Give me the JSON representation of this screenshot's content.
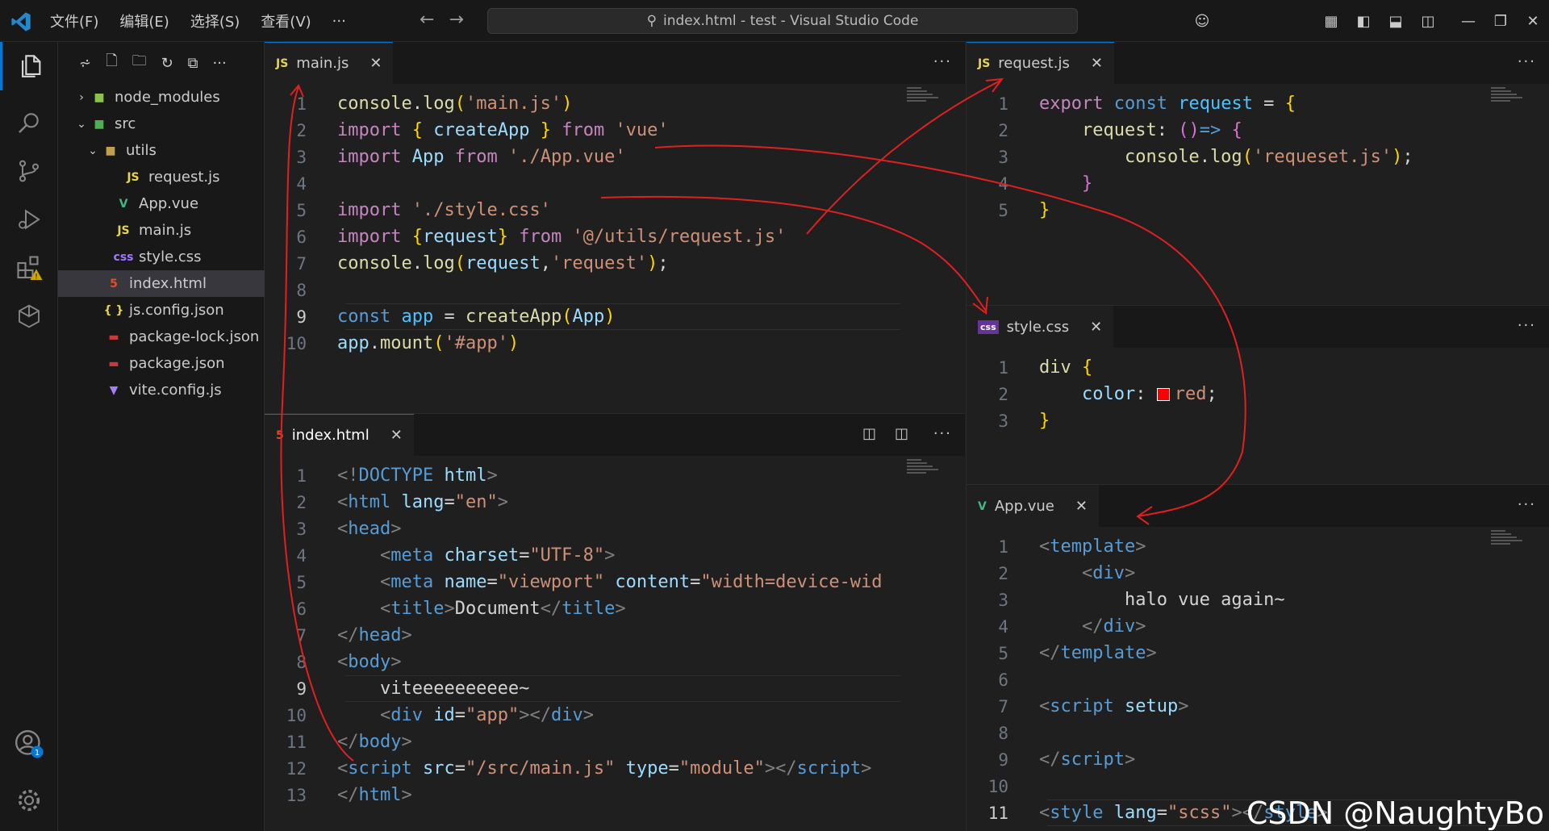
{
  "window": {
    "title": "index.html - test - Visual Studio Code"
  },
  "menu": {
    "items": [
      "文件(F)",
      "编辑(E)",
      "选择(S)",
      "查看(V)",
      "···"
    ]
  },
  "explorer": {
    "items": [
      {
        "label": "node_modules",
        "icon": "folder-node-icon"
      },
      {
        "label": "src",
        "icon": "folder-src-icon"
      },
      {
        "label": "utils",
        "icon": "folder-utils-icon"
      },
      {
        "label": "request.js",
        "icon": "js-file-icon"
      },
      {
        "label": "App.vue",
        "icon": "vue-file-icon"
      },
      {
        "label": "main.js",
        "icon": "js-file-icon"
      },
      {
        "label": "style.css",
        "icon": "css-file-icon"
      },
      {
        "label": "index.html",
        "icon": "html-file-icon"
      },
      {
        "label": "js.config.json",
        "icon": "json-file-icon"
      },
      {
        "label": "package-lock.json",
        "icon": "npm-file-icon"
      },
      {
        "label": "package.json",
        "icon": "npm-file-icon"
      },
      {
        "label": "vite.config.js",
        "icon": "vite-file-icon"
      }
    ]
  },
  "icons": {
    "js": "JS",
    "css": "css",
    "html": "5",
    "json": "{ }",
    "vue": "V"
  },
  "editors": {
    "main": {
      "tab": "main.js",
      "lines": [
        {
          "n": "1",
          "tokens": [
            [
              "fn",
              "console"
            ],
            [
              "pl",
              "."
            ],
            [
              "fn",
              "log"
            ],
            [
              "br",
              "("
            ],
            [
              "st",
              "'main.js'"
            ],
            [
              "br",
              ")"
            ]
          ]
        },
        {
          "n": "2",
          "tokens": [
            [
              "kc",
              "import"
            ],
            [
              "pl",
              " "
            ],
            [
              "br",
              "{"
            ],
            [
              "pl",
              " "
            ],
            [
              "vr",
              "createApp"
            ],
            [
              "pl",
              " "
            ],
            [
              "br",
              "}"
            ],
            [
              "pl",
              " "
            ],
            [
              "kc",
              "from"
            ],
            [
              "pl",
              " "
            ],
            [
              "st",
              "'vue'"
            ]
          ]
        },
        {
          "n": "3",
          "tokens": [
            [
              "kc",
              "import"
            ],
            [
              "pl",
              " "
            ],
            [
              "vr",
              "App"
            ],
            [
              "pl",
              " "
            ],
            [
              "kc",
              "from"
            ],
            [
              "pl",
              " "
            ],
            [
              "st",
              "'./App.vue'"
            ]
          ]
        },
        {
          "n": "4",
          "tokens": []
        },
        {
          "n": "5",
          "tokens": [
            [
              "kc",
              "import"
            ],
            [
              "pl",
              " "
            ],
            [
              "st",
              "'./style.css'"
            ]
          ]
        },
        {
          "n": "6",
          "tokens": [
            [
              "kc",
              "import"
            ],
            [
              "pl",
              " "
            ],
            [
              "br",
              "{"
            ],
            [
              "vr",
              "request"
            ],
            [
              "br",
              "}"
            ],
            [
              "pl",
              " "
            ],
            [
              "kc",
              "from"
            ],
            [
              "pl",
              " "
            ],
            [
              "st",
              "'@/utils/request.js'"
            ]
          ]
        },
        {
          "n": "7",
          "tokens": [
            [
              "fn",
              "console"
            ],
            [
              "pl",
              "."
            ],
            [
              "fn",
              "log"
            ],
            [
              "br",
              "("
            ],
            [
              "vr",
              "request"
            ],
            [
              "pl",
              ","
            ],
            [
              "st",
              "'request'"
            ],
            [
              "br",
              ")"
            ],
            [
              "pl",
              ";"
            ]
          ]
        },
        {
          "n": "8",
          "tokens": []
        },
        {
          "n": "9",
          "tokens": [
            [
              "kw",
              "const"
            ],
            [
              "pl",
              " "
            ],
            [
              "cn",
              "app"
            ],
            [
              "pl",
              " = "
            ],
            [
              "fn",
              "createApp"
            ],
            [
              "br",
              "("
            ],
            [
              "vr",
              "App"
            ],
            [
              "br",
              ")"
            ]
          ]
        },
        {
          "n": "10",
          "tokens": [
            [
              "vr",
              "app"
            ],
            [
              "pl",
              "."
            ],
            [
              "fn",
              "mount"
            ],
            [
              "br",
              "("
            ],
            [
              "st",
              "'#app'"
            ],
            [
              "br",
              ")"
            ]
          ]
        }
      ]
    },
    "index": {
      "tab": "index.html",
      "lines": [
        {
          "n": "1",
          "tokens": [
            [
              "pu",
              "<!"
            ],
            [
              "tg",
              "DOCTYPE"
            ],
            [
              "pl",
              " "
            ],
            [
              "at",
              "html"
            ],
            [
              "pu",
              ">"
            ]
          ]
        },
        {
          "n": "2",
          "tokens": [
            [
              "pu",
              "<"
            ],
            [
              "tg",
              "html"
            ],
            [
              "pl",
              " "
            ],
            [
              "at",
              "lang"
            ],
            [
              "pl",
              "="
            ],
            [
              "st",
              "\"en\""
            ],
            [
              "pu",
              ">"
            ]
          ]
        },
        {
          "n": "3",
          "tokens": [
            [
              "pu",
              "<"
            ],
            [
              "tg",
              "head"
            ],
            [
              "pu",
              ">"
            ]
          ]
        },
        {
          "n": "4",
          "tokens": [
            [
              "pl",
              "    "
            ],
            [
              "pu",
              "<"
            ],
            [
              "tg",
              "meta"
            ],
            [
              "pl",
              " "
            ],
            [
              "at",
              "charset"
            ],
            [
              "pl",
              "="
            ],
            [
              "st",
              "\"UTF-8\""
            ],
            [
              "pu",
              ">"
            ]
          ]
        },
        {
          "n": "5",
          "tokens": [
            [
              "pl",
              "    "
            ],
            [
              "pu",
              "<"
            ],
            [
              "tg",
              "meta"
            ],
            [
              "pl",
              " "
            ],
            [
              "at",
              "name"
            ],
            [
              "pl",
              "="
            ],
            [
              "st",
              "\"viewport\""
            ],
            [
              "pl",
              " "
            ],
            [
              "at",
              "content"
            ],
            [
              "pl",
              "="
            ],
            [
              "st",
              "\"width=device-wid"
            ]
          ]
        },
        {
          "n": "6",
          "tokens": [
            [
              "pl",
              "    "
            ],
            [
              "pu",
              "<"
            ],
            [
              "tg",
              "title"
            ],
            [
              "pu",
              ">"
            ],
            [
              "pl",
              "Document"
            ],
            [
              "pu",
              "</"
            ],
            [
              "tg",
              "title"
            ],
            [
              "pu",
              ">"
            ]
          ]
        },
        {
          "n": "7",
          "tokens": [
            [
              "pu",
              "</"
            ],
            [
              "tg",
              "head"
            ],
            [
              "pu",
              ">"
            ]
          ]
        },
        {
          "n": "8",
          "tokens": [
            [
              "pu",
              "<"
            ],
            [
              "tg",
              "body"
            ],
            [
              "pu",
              ">"
            ]
          ]
        },
        {
          "n": "9",
          "tokens": [
            [
              "pl",
              "    viteeeeeeeeee~"
            ]
          ]
        },
        {
          "n": "10",
          "tokens": [
            [
              "pl",
              "    "
            ],
            [
              "pu",
              "<"
            ],
            [
              "tg",
              "div"
            ],
            [
              "pl",
              " "
            ],
            [
              "at",
              "id"
            ],
            [
              "pl",
              "="
            ],
            [
              "st",
              "\"app\""
            ],
            [
              "pu",
              "></"
            ],
            [
              "tg",
              "div"
            ],
            [
              "pu",
              ">"
            ]
          ]
        },
        {
          "n": "11",
          "tokens": [
            [
              "pu",
              "</"
            ],
            [
              "tg",
              "body"
            ],
            [
              "pu",
              ">"
            ]
          ]
        },
        {
          "n": "12",
          "tokens": [
            [
              "pu",
              "<"
            ],
            [
              "tg",
              "script"
            ],
            [
              "pl",
              " "
            ],
            [
              "at",
              "src"
            ],
            [
              "pl",
              "="
            ],
            [
              "st",
              "\"/src/main.js\""
            ],
            [
              "pl",
              " "
            ],
            [
              "at",
              "type"
            ],
            [
              "pl",
              "="
            ],
            [
              "st",
              "\"module\""
            ],
            [
              "pu",
              "></"
            ],
            [
              "tg",
              "script"
            ],
            [
              "pu",
              ">"
            ]
          ]
        },
        {
          "n": "13",
          "tokens": [
            [
              "pu",
              "</"
            ],
            [
              "tg",
              "html"
            ],
            [
              "pu",
              ">"
            ]
          ]
        }
      ]
    },
    "request": {
      "tab": "request.js",
      "lines": [
        {
          "n": "1",
          "tokens": [
            [
              "kc",
              "export"
            ],
            [
              "pl",
              " "
            ],
            [
              "kw",
              "const"
            ],
            [
              "pl",
              " "
            ],
            [
              "cn",
              "request"
            ],
            [
              "pl",
              " = "
            ],
            [
              "br",
              "{"
            ]
          ]
        },
        {
          "n": "2",
          "tokens": [
            [
              "pl",
              "    "
            ],
            [
              "fn",
              "request"
            ],
            [
              "pl",
              ": "
            ],
            [
              "br2",
              "()"
            ],
            [
              "kw",
              "=>"
            ],
            [
              "pl",
              " "
            ],
            [
              "br2",
              "{"
            ]
          ]
        },
        {
          "n": "3",
          "tokens": [
            [
              "pl",
              "        "
            ],
            [
              "fn",
              "console"
            ],
            [
              "pl",
              "."
            ],
            [
              "fn",
              "log"
            ],
            [
              "br",
              "("
            ],
            [
              "st",
              "'requeset.js'"
            ],
            [
              "br",
              ")"
            ],
            [
              "pl",
              ";"
            ]
          ]
        },
        {
          "n": "4",
          "tokens": [
            [
              "pl",
              "    "
            ],
            [
              "br2",
              "}"
            ]
          ]
        },
        {
          "n": "5",
          "tokens": [
            [
              "br",
              "}"
            ]
          ]
        }
      ]
    },
    "style": {
      "tab": "style.css",
      "lines": [
        {
          "n": "1",
          "tokens": [
            [
              "fn",
              "div"
            ],
            [
              "pl",
              " "
            ],
            [
              "br",
              "{"
            ]
          ]
        },
        {
          "n": "2",
          "tokens": [
            [
              "pl",
              "    "
            ],
            [
              "vr",
              "color"
            ],
            [
              "pl",
              ": "
            ],
            [
              "swatch",
              ""
            ],
            [
              "st",
              "red"
            ],
            [
              "pl",
              ";"
            ]
          ]
        },
        {
          "n": "3",
          "tokens": [
            [
              "br",
              "}"
            ]
          ]
        }
      ]
    },
    "app": {
      "tab": "App.vue",
      "lines": [
        {
          "n": "1",
          "tokens": [
            [
              "pu",
              "<"
            ],
            [
              "tg",
              "template"
            ],
            [
              "pu",
              ">"
            ]
          ]
        },
        {
          "n": "2",
          "tokens": [
            [
              "pl",
              "    "
            ],
            [
              "pu",
              "<"
            ],
            [
              "tg",
              "div"
            ],
            [
              "pu",
              ">"
            ]
          ]
        },
        {
          "n": "3",
          "tokens": [
            [
              "pl",
              "        halo vue again~"
            ]
          ]
        },
        {
          "n": "4",
          "tokens": [
            [
              "pl",
              "    "
            ],
            [
              "pu",
              "</"
            ],
            [
              "tg",
              "div"
            ],
            [
              "pu",
              ">"
            ]
          ]
        },
        {
          "n": "5",
          "tokens": [
            [
              "pu",
              "</"
            ],
            [
              "tg",
              "template"
            ],
            [
              "pu",
              ">"
            ]
          ]
        },
        {
          "n": "6",
          "tokens": []
        },
        {
          "n": "7",
          "tokens": [
            [
              "pu",
              "<"
            ],
            [
              "tg",
              "script"
            ],
            [
              "pl",
              " "
            ],
            [
              "at",
              "setup"
            ],
            [
              "pu",
              ">"
            ]
          ]
        },
        {
          "n": "8",
          "tokens": []
        },
        {
          "n": "9",
          "tokens": [
            [
              "pu",
              "</"
            ],
            [
              "tg",
              "script"
            ],
            [
              "pu",
              ">"
            ]
          ]
        },
        {
          "n": "10",
          "tokens": []
        },
        {
          "n": "11",
          "tokens": [
            [
              "pu",
              "<"
            ],
            [
              "tg",
              "style"
            ],
            [
              "pl",
              " "
            ],
            [
              "at",
              "lang"
            ],
            [
              "pl",
              "="
            ],
            [
              "st",
              "\"scss\""
            ],
            [
              "pu",
              "></"
            ],
            [
              "tg",
              "style"
            ],
            [
              "pu",
              ">"
            ]
          ]
        }
      ]
    }
  },
  "watermark": "CSDN @NaughtyBo",
  "colors": {
    "accent": "#0078d4",
    "ink": "#e02020"
  }
}
